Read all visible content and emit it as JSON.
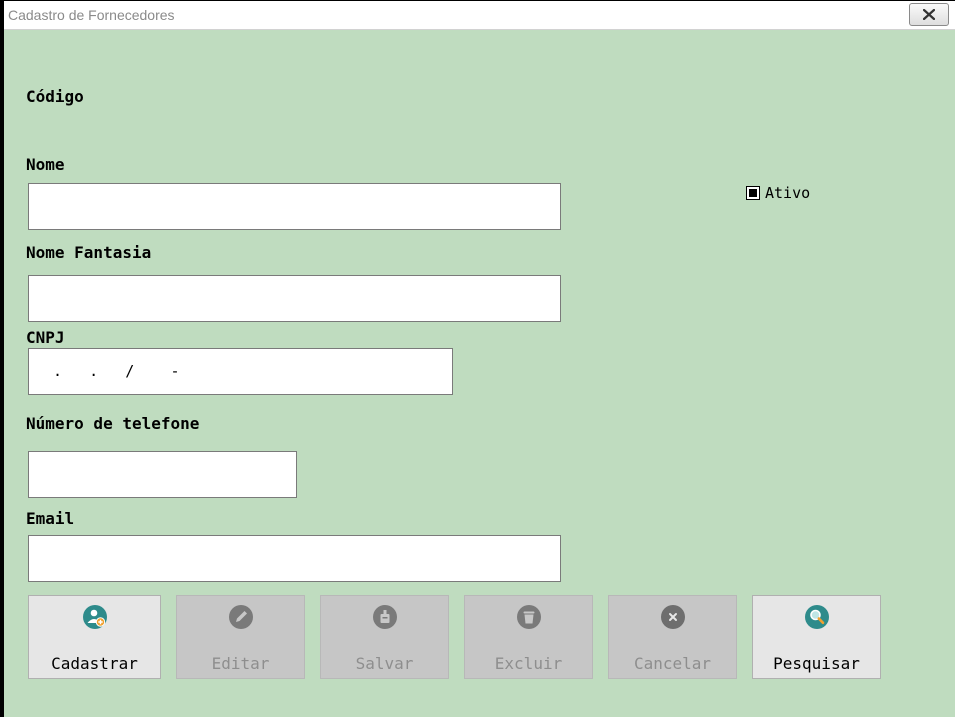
{
  "window": {
    "title": "Cadastro de Fornecedores"
  },
  "form": {
    "codigo_label": "Código",
    "nome_label": "Nome",
    "nome_value": "",
    "nome_fantasia_label": "Nome Fantasia",
    "nome_fantasia_value": "",
    "cnpj_label": "CNPJ",
    "cnpj_value": "  .   .   /    -  ",
    "telefone_label": "Número de telefone",
    "telefone_value": "",
    "email_label": "Email",
    "email_value": "",
    "ativo_label": "Ativo",
    "ativo_checked": true
  },
  "buttons": [
    {
      "label": "Cadastrar",
      "icon": "add-user-icon",
      "enabled": true,
      "color": "#2e8b8b"
    },
    {
      "label": "Editar",
      "icon": "pencil-icon",
      "enabled": false,
      "color": "#7a7a7a"
    },
    {
      "label": "Salvar",
      "icon": "save-icon",
      "enabled": false,
      "color": "#7a7a7a"
    },
    {
      "label": "Excluir",
      "icon": "trash-icon",
      "enabled": false,
      "color": "#7a7a7a"
    },
    {
      "label": "Cancelar",
      "icon": "cancel-icon",
      "enabled": false,
      "color": "#7a7a7a"
    },
    {
      "label": "Pesquisar",
      "icon": "search-icon",
      "enabled": true,
      "color": "#2e8b8b"
    }
  ],
  "colors": {
    "background": "#bfdcbf",
    "accent": "#2e8b8b",
    "badge": "#f0a030"
  }
}
